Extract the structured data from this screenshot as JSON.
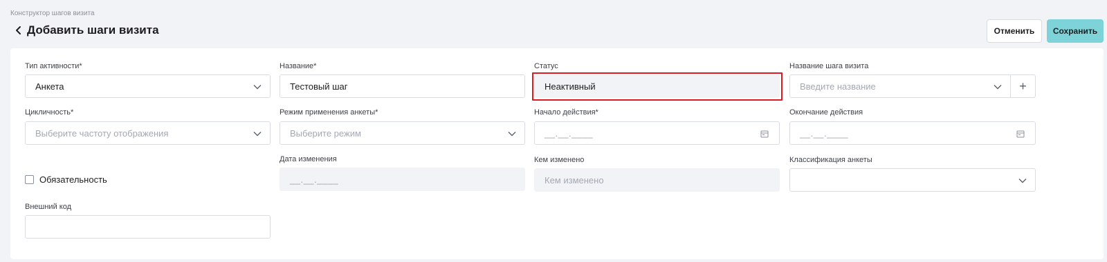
{
  "breadcrumb": "Конструктор шагов визита",
  "title": "Добавить шаги визита",
  "buttons": {
    "cancel": "Отменить",
    "save": "Сохранить"
  },
  "colors": {
    "accent": "#7dd3d8",
    "highlight": "#e0191e"
  },
  "form": {
    "activity_type": {
      "label": "Тип активности*",
      "value": "Анкета"
    },
    "name": {
      "label": "Название*",
      "value": "Тестовый шаг"
    },
    "status": {
      "label": "Статус",
      "value": "Неактивный"
    },
    "step_name": {
      "label": "Название шага визита",
      "placeholder": "Введите название",
      "add_label": "+"
    },
    "cyclicity": {
      "label": "Цикличность*",
      "placeholder": "Выберите частоту отображения"
    },
    "mode": {
      "label": "Режим применения анкеты*",
      "placeholder": "Выберите режим"
    },
    "start_date": {
      "label": "Начало действия*",
      "mask": "__.__.____"
    },
    "end_date": {
      "label": "Окончание действия",
      "mask": "__.__.____"
    },
    "required": {
      "label": "Обязательность",
      "checked": false
    },
    "change_date": {
      "label": "Дата изменения",
      "mask": "__.__.____"
    },
    "changed_by": {
      "label": "Кем изменено",
      "placeholder": "Кем изменено"
    },
    "classification": {
      "label": "Классификация анкеты",
      "value": ""
    },
    "external_code": {
      "label": "Внешний код",
      "value": ""
    }
  }
}
